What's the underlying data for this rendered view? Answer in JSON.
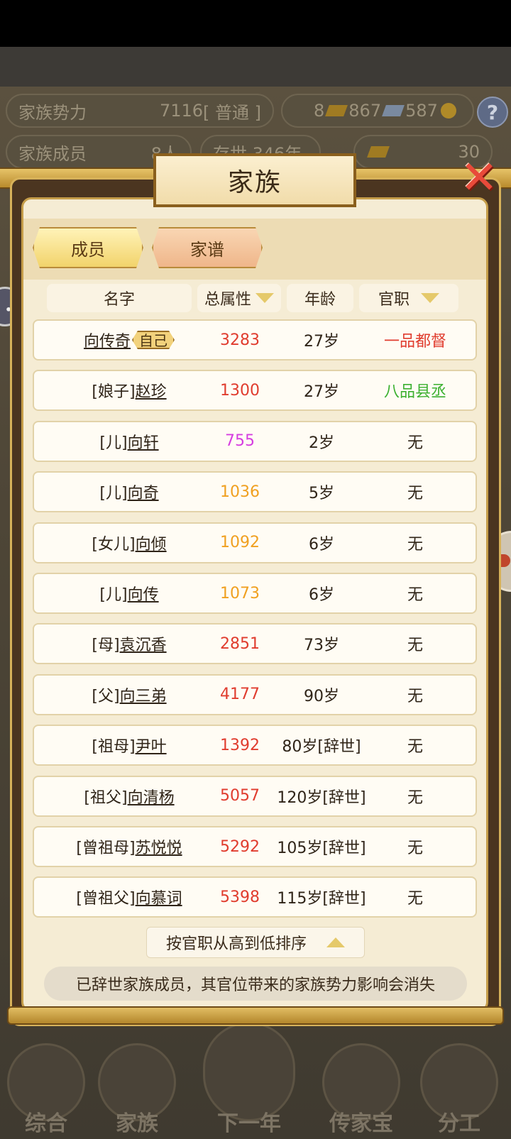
{
  "background": {
    "stats": {
      "power_label": "家族势力",
      "power_value": "7116",
      "power_rank": "[ 普通 ]",
      "currency_1": "8",
      "currency_2": "867",
      "currency_3": "587",
      "members_label": "家族成员",
      "members_value": "8人",
      "generation_text": "存世 346年",
      "gold_value": "30"
    },
    "bottom_nav": [
      {
        "label": "综合"
      },
      {
        "label": "家族"
      },
      {
        "label": "下一年"
      },
      {
        "label": "传家宝"
      },
      {
        "label": "分工"
      }
    ]
  },
  "modal": {
    "title": "家族",
    "close_symbol": "✕",
    "tabs": [
      {
        "label": "成员",
        "active": true
      },
      {
        "label": "家谱",
        "active": false
      }
    ],
    "columns": {
      "name": "名字",
      "attr": "总属性",
      "age": "年龄",
      "office": "官职"
    },
    "rows": [
      {
        "prefix": "",
        "name": "向传奇",
        "tag": "自己",
        "attr": "3283",
        "attr_color": "#e03c2e",
        "age": "27岁",
        "office": "一品都督",
        "office_color": "#e03c2e"
      },
      {
        "prefix": "[娘子]",
        "name": "赵珍",
        "tag": "",
        "attr": "1300",
        "attr_color": "#e03c2e",
        "age": "27岁",
        "office": "八品县丞",
        "office_color": "#3cb030"
      },
      {
        "prefix": "[儿]",
        "name": "向轩",
        "tag": "",
        "attr": "755",
        "attr_color": "#d63ee0",
        "age": "2岁",
        "office": "无",
        "office_color": "#2f2418"
      },
      {
        "prefix": "[儿]",
        "name": "向奇",
        "tag": "",
        "attr": "1036",
        "attr_color": "#f0a020",
        "age": "5岁",
        "office": "无",
        "office_color": "#2f2418"
      },
      {
        "prefix": "[女儿]",
        "name": "向倾",
        "tag": "",
        "attr": "1092",
        "attr_color": "#f0a020",
        "age": "6岁",
        "office": "无",
        "office_color": "#2f2418"
      },
      {
        "prefix": "[儿]",
        "name": "向传",
        "tag": "",
        "attr": "1073",
        "attr_color": "#f0a020",
        "age": "6岁",
        "office": "无",
        "office_color": "#2f2418"
      },
      {
        "prefix": "[母]",
        "name": "袁沉香",
        "tag": "",
        "attr": "2851",
        "attr_color": "#e03c2e",
        "age": "73岁",
        "office": "无",
        "office_color": "#2f2418"
      },
      {
        "prefix": "[父]",
        "name": "向三弟",
        "tag": "",
        "attr": "4177",
        "attr_color": "#e03c2e",
        "age": "90岁",
        "office": "无",
        "office_color": "#2f2418"
      },
      {
        "prefix": "[祖母]",
        "name": "尹叶",
        "tag": "",
        "attr": "1392",
        "attr_color": "#e03c2e",
        "age": "80岁[辞世]",
        "office": "无",
        "office_color": "#2f2418"
      },
      {
        "prefix": "[祖父]",
        "name": "向清杨",
        "tag": "",
        "attr": "5057",
        "attr_color": "#e03c2e",
        "age": "120岁[辞世]",
        "office": "无",
        "office_color": "#2f2418"
      },
      {
        "prefix": "[曾祖母]",
        "name": "苏悦悦",
        "tag": "",
        "attr": "5292",
        "attr_color": "#e03c2e",
        "age": "105岁[辞世]",
        "office": "无",
        "office_color": "#2f2418"
      },
      {
        "prefix": "[曾祖父]",
        "name": "向慕词",
        "tag": "",
        "attr": "5398",
        "attr_color": "#e03c2e",
        "age": "115岁[辞世]",
        "office": "无",
        "office_color": "#2f2418"
      }
    ],
    "sort_button": "按官职从高到低排序",
    "notice": "已辞世家族成员，其官位带来的家族势力影响会消失"
  },
  "icons": {
    "sort_attr": "sort-triangle-down-icon",
    "sort_office": "sort-triangle-down-icon",
    "sort_toggle": "sort-triangle-up-icon",
    "close": "close-x-icon",
    "help": "help-icon"
  }
}
